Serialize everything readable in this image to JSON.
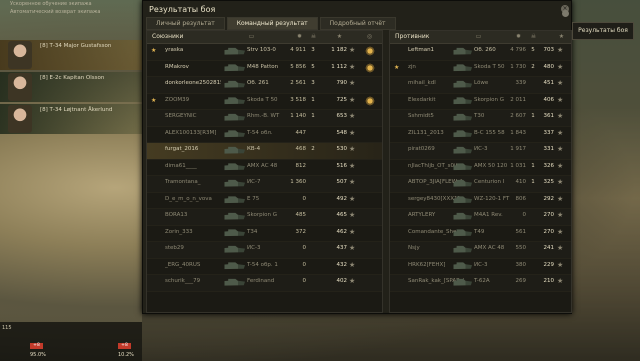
{
  "window": {
    "title": "Результаты боя",
    "tabs": [
      {
        "label": "Личный результат",
        "active": false
      },
      {
        "label": "Командный результат",
        "active": true
      },
      {
        "label": "Подробный отчёт",
        "active": false
      }
    ],
    "tooltip": "Результаты боя"
  },
  "notifications": [
    "Ускоренное обучение экипажа",
    "Автоматический возврат экипажа"
  ],
  "crew": [
    {
      "name": "[8] Т-34 Major Gustafsson",
      "selected": true
    },
    {
      "name": "[8] Е-2с Kapitan Olsson",
      "selected": false
    },
    {
      "name": "[8] Т-34 Løjtnant Åkerlund",
      "selected": false
    }
  ],
  "minimap": {
    "count": "115",
    "hp_badge": "+8",
    "pct_left": "95.0%",
    "hp_badge2": "+8",
    "pct_right": "10.2%"
  },
  "allies": {
    "title": "Союзники",
    "players": [
      {
        "name": "yraska",
        "tank": "Strv 103-0",
        "damage": "4 911",
        "kills": "3",
        "xp": "1 182",
        "medal": true,
        "me": false,
        "dead": false,
        "platoon": "★"
      },
      {
        "name": "RMakrov",
        "tank": "M48 Patton",
        "damage": "5 856",
        "kills": "5",
        "xp": "1 112",
        "medal": true,
        "me": false,
        "dead": false,
        "platoon": ""
      },
      {
        "name": "donkorleone2502815...",
        "tank": "Об. 261",
        "damage": "2 561",
        "kills": "3",
        "xp": "790",
        "medal": false,
        "me": false,
        "dead": false,
        "platoon": ""
      },
      {
        "name": "ZOOM39",
        "tank": "Škoda T 50",
        "damage": "3 518",
        "kills": "1",
        "xp": "725",
        "medal": true,
        "me": false,
        "dead": true,
        "platoon": "★"
      },
      {
        "name": "SERGEYNIC",
        "tank": "Rhm.-B. WT",
        "damage": "1 140",
        "kills": "1",
        "xp": "653",
        "medal": false,
        "me": false,
        "dead": true,
        "platoon": ""
      },
      {
        "name": "ALEX100133[R3M]",
        "tank": "T-54 обл.",
        "damage": "447",
        "kills": "",
        "xp": "548",
        "medal": false,
        "me": false,
        "dead": true,
        "platoon": ""
      },
      {
        "name": "furgat_2016",
        "tank": "КВ-4",
        "damage": "468",
        "kills": "2",
        "xp": "530",
        "medal": false,
        "me": true,
        "dead": false,
        "platoon": ""
      },
      {
        "name": "dima61____",
        "tank": "AMX AC 48",
        "damage": "812",
        "kills": "",
        "xp": "516",
        "medal": false,
        "me": false,
        "dead": true,
        "platoon": ""
      },
      {
        "name": "Tramontana_",
        "tank": "ИС-7",
        "damage": "1 360",
        "kills": "",
        "xp": "507",
        "medal": false,
        "me": false,
        "dead": true,
        "platoon": ""
      },
      {
        "name": "D_e_m_o_n_vova",
        "tank": "E 75",
        "damage": "0",
        "kills": "",
        "xp": "492",
        "medal": false,
        "me": false,
        "dead": true,
        "platoon": ""
      },
      {
        "name": "BORA13",
        "tank": "Skorpion G",
        "damage": "485",
        "kills": "",
        "xp": "465",
        "medal": false,
        "me": false,
        "dead": true,
        "platoon": ""
      },
      {
        "name": "Zorin_333",
        "tank": "T34",
        "damage": "372",
        "kills": "",
        "xp": "462",
        "medal": false,
        "me": false,
        "dead": true,
        "platoon": ""
      },
      {
        "name": "steb29",
        "tank": "ИС-3",
        "damage": "0",
        "kills": "",
        "xp": "437",
        "medal": false,
        "me": false,
        "dead": true,
        "platoon": ""
      },
      {
        "name": "_ERG_40RUS",
        "tank": "T-54 обр. 1",
        "damage": "0",
        "kills": "",
        "xp": "432",
        "medal": false,
        "me": false,
        "dead": true,
        "platoon": ""
      },
      {
        "name": "schurik___79",
        "tank": "Ferdinand",
        "damage": "0",
        "kills": "",
        "xp": "402",
        "medal": false,
        "me": false,
        "dead": true,
        "platoon": ""
      }
    ]
  },
  "enemies": {
    "title": "Противник",
    "players": [
      {
        "name": "Leftman1",
        "tank": "Об. 260",
        "damage": "4 796",
        "kills": "5",
        "xp": "703",
        "dead": false,
        "platoon": ""
      },
      {
        "name": "zjn",
        "tank": "Škoda T 50",
        "damage": "1 730",
        "kills": "2",
        "xp": "480",
        "dead": true,
        "platoon": "★"
      },
      {
        "name": "mihail_kdl",
        "tank": "Löwe",
        "damage": "339",
        "kills": "",
        "xp": "451",
        "dead": true,
        "platoon": ""
      },
      {
        "name": "Elexdarkit",
        "tank": "Skorpion G",
        "damage": "2 011",
        "kills": "",
        "xp": "406",
        "dead": true,
        "platoon": ""
      },
      {
        "name": "Sshmidt5",
        "tank": "T30",
        "damage": "2 607",
        "kills": "1",
        "xp": "361",
        "dead": true,
        "platoon": ""
      },
      {
        "name": "ZIL131_2013",
        "tank": "B-C 155 58",
        "damage": "1 843",
        "kills": "",
        "xp": "337",
        "dead": true,
        "platoon": ""
      },
      {
        "name": "pirat0269",
        "tank": "ИС-3",
        "damage": "1 917",
        "kills": "",
        "xp": "331",
        "dead": true,
        "platoon": ""
      },
      {
        "name": "nJlacThljb_OT_s0jim",
        "tank": "AMX 50 120",
        "damage": "1 031",
        "kills": "1",
        "xp": "326",
        "dead": true,
        "platoon": ""
      },
      {
        "name": "ABTOP_3JIA[FLEW_]",
        "tank": "Centurion I",
        "damage": "410",
        "kills": "1",
        "xp": "325",
        "dead": true,
        "platoon": ""
      },
      {
        "name": "sergey8430[XXX1]",
        "tank": "WZ-120-1 FT",
        "damage": "806",
        "kills": "",
        "xp": "292",
        "dead": true,
        "platoon": ""
      },
      {
        "name": "ARTYLERY",
        "tank": "M4A1 Rev.",
        "damage": "0",
        "kills": "",
        "xp": "270",
        "dead": true,
        "platoon": ""
      },
      {
        "name": "Comandante_She",
        "tank": "T49",
        "damage": "561",
        "kills": "",
        "xp": "270",
        "dead": true,
        "platoon": ""
      },
      {
        "name": "Nsjy",
        "tank": "AMX AC 48",
        "damage": "550",
        "kills": "",
        "xp": "241",
        "dead": true,
        "platoon": ""
      },
      {
        "name": "HRK62[FEHX]",
        "tank": "ИС-3",
        "damage": "380",
        "kills": "",
        "xp": "229",
        "dead": true,
        "platoon": ""
      },
      {
        "name": "SanRak_kak_[SPAR_]",
        "tank": "T-62A",
        "damage": "269",
        "kills": "",
        "xp": "210",
        "dead": true,
        "platoon": ""
      }
    ]
  },
  "colors": {
    "accent": "#e3b653",
    "panel": "#1b1a14",
    "window": "#222119"
  }
}
